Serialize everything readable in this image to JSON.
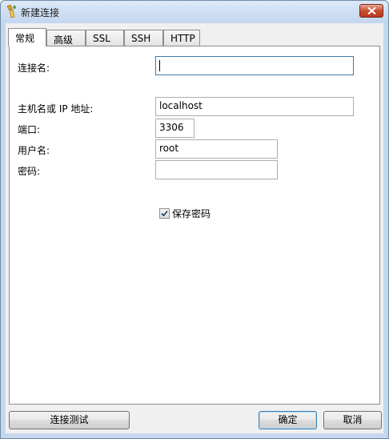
{
  "window": {
    "title": "新建连接",
    "close_icon": "close-icon"
  },
  "tabs": [
    {
      "label": "常规",
      "active": true
    },
    {
      "label": "高级",
      "active": false
    },
    {
      "label": "SSL",
      "active": false
    },
    {
      "label": "SSH",
      "active": false
    },
    {
      "label": "HTTP",
      "active": false
    }
  ],
  "form": {
    "connection_name": {
      "label": "连接名:",
      "value": ""
    },
    "host": {
      "label": "主机名或 IP 地址:",
      "value": "localhost"
    },
    "port": {
      "label": "端口:",
      "value": "3306"
    },
    "username": {
      "label": "用户名:",
      "value": "root"
    },
    "password": {
      "label": "密码:",
      "value": ""
    },
    "save_password": {
      "label": "保存密码",
      "checked": true
    }
  },
  "buttons": {
    "test": "连接测试",
    "ok": "确定",
    "cancel": "取消"
  },
  "colors": {
    "accent": "#3c7fb1",
    "close": "#c94c2f"
  }
}
